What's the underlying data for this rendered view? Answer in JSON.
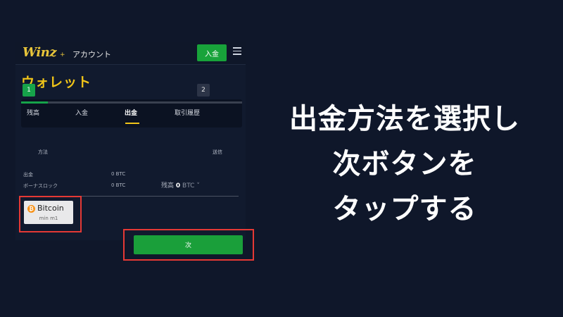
{
  "header": {
    "logo": "Winz",
    "logo_plus": "+",
    "account": "アカウント",
    "deposit_button": "入金",
    "menu_icon": "hamburger-menu-icon"
  },
  "wallet": {
    "title": "ウォレット",
    "tabs": [
      {
        "label": "残高",
        "active": false
      },
      {
        "label": "入金",
        "active": false
      },
      {
        "label": "出金",
        "active": true
      },
      {
        "label": "取引履歴",
        "active": false
      }
    ],
    "steps": [
      {
        "number": "1",
        "label": "方法",
        "active": true
      },
      {
        "number": "2",
        "label": "送信",
        "active": false
      }
    ],
    "progress": 0.12,
    "balances": [
      {
        "label": "出金",
        "value": "0 BTC"
      },
      {
        "label": "ボーナスロック",
        "value": "0 BTC"
      }
    ],
    "residual": {
      "label": "残高",
      "value": "0",
      "currency": "BTC ˅"
    },
    "methods": [
      {
        "name": "Bitcoin",
        "min": "min m1",
        "icon": "bitcoin-icon",
        "icon_glyph": "₿"
      }
    ],
    "next_button": "次"
  },
  "caption": {
    "lines": [
      "出金方法を選択し",
      "次ボタンを",
      "タップする"
    ]
  },
  "colors": {
    "background": "#0f172a",
    "accent_green": "#18a33a",
    "accent_yellow": "#f0c419",
    "highlight_red": "#e53935",
    "bitcoin_orange": "#f7931a"
  }
}
